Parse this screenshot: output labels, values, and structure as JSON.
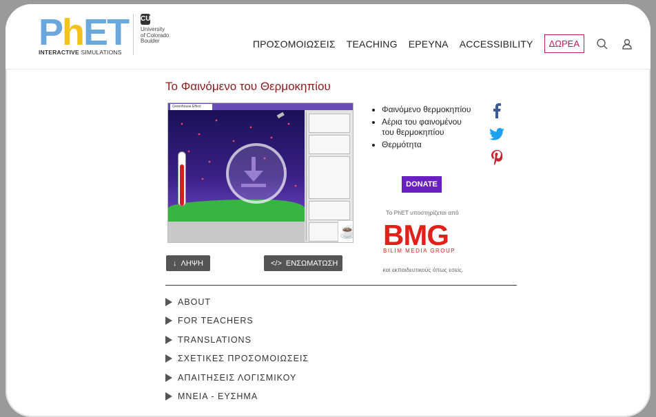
{
  "header": {
    "logo": {
      "letters": [
        "P",
        "h",
        "E",
        "T"
      ],
      "tagline_bold": "INTERACTIVE",
      "tagline_rest": "SIMULATIONS"
    },
    "university": {
      "line1": "University",
      "line2": "of Colorado",
      "line3": "Boulder"
    },
    "nav": {
      "simulations": "ΠΡΟΣΟΜΟΙΩΣΕΙΣ",
      "teaching": "TEACHING",
      "research": "ΕΡΕΥΝΑ",
      "accessibility": "ACCESSIBILITY",
      "donate": "ΔΩΡΕΑ"
    }
  },
  "page": {
    "title": "Το Φαινόμενο του Θερμοκηπίου",
    "sim_tab": "Greenhouse Effect",
    "download_label": "ΛΗΨΗ",
    "embed_label": "ΕΝΣΩΜΑΤΩΣΗ",
    "topics": [
      "Φαινόμενο θερμοκηπίου",
      "Αέρια του φαινομένου του θερμοκηπίου",
      "Θερμότητα"
    ],
    "donate_button": "DONATE",
    "sponsor_text": "Το PhET υποστηρίζεται από",
    "sponsor_logo": "BMG",
    "sponsor_logo_sub": "BILIM MEDIA GROUP",
    "sponsor_text2": "και εκπαιδευτικούς όπως εσείς."
  },
  "accordion": [
    "ABOUT",
    "FOR TEACHERS",
    "TRANSLATIONS",
    "ΣΧΕΤΙΚΕΣ ΠΡΟΣΟΜΟΙΩΣΕΙΣ",
    "ΑΠΑΙΤΗΣΕΙΣ ΛΟΓΙΣΜΙΚΟΥ",
    "ΜΝΕΙΑ - ΕΥΣΗΜΑ"
  ],
  "icons": {
    "search": "search-icon",
    "user": "user-icon",
    "facebook": "facebook-icon",
    "twitter": "twitter-icon",
    "pinterest": "pinterest-icon"
  },
  "colors": {
    "title": "#8b1a1a",
    "donate_accent": "#c2185b",
    "donate_button": "#6a1fc2",
    "sponsor": "#e0211a"
  }
}
